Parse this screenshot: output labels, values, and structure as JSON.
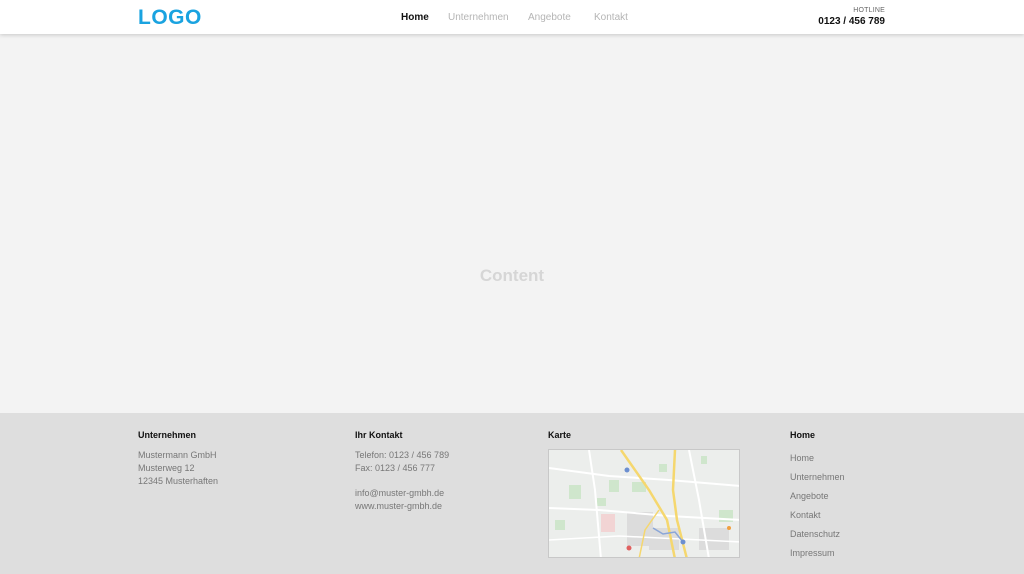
{
  "header": {
    "logo": "LOGO",
    "nav": [
      {
        "label": "Home",
        "active": true
      },
      {
        "label": "Unternehmen",
        "active": false
      },
      {
        "label": "Angebote",
        "active": false
      },
      {
        "label": "Kontakt",
        "active": false
      }
    ],
    "hotline_label": "HOTLINE",
    "hotline_number": "0123 / 456 789"
  },
  "content": {
    "label": "Content"
  },
  "footer": {
    "company": {
      "title": "Unternehmen",
      "lines": [
        "Mustermann GmbH",
        "Musterweg 12",
        "12345 Musterhaften"
      ]
    },
    "contact": {
      "title": "Ihr Kontakt",
      "phone": "Telefon: 0123 / 456 789",
      "fax": "Fax: 0123 / 456 777",
      "email": "info@muster-gmbh.de",
      "web": "www.muster-gmbh.de"
    },
    "map": {
      "title": "Karte"
    },
    "links": {
      "title": "Home",
      "items": [
        "Home",
        "Unternehmen",
        "Angebote",
        "Kontakt",
        "Datenschutz",
        "Impressum"
      ]
    }
  },
  "colors": {
    "brand": "#1aa3e0",
    "header_bg": "#ffffff",
    "content_bg": "#f3f3f3",
    "footer_bg": "#dedede"
  }
}
